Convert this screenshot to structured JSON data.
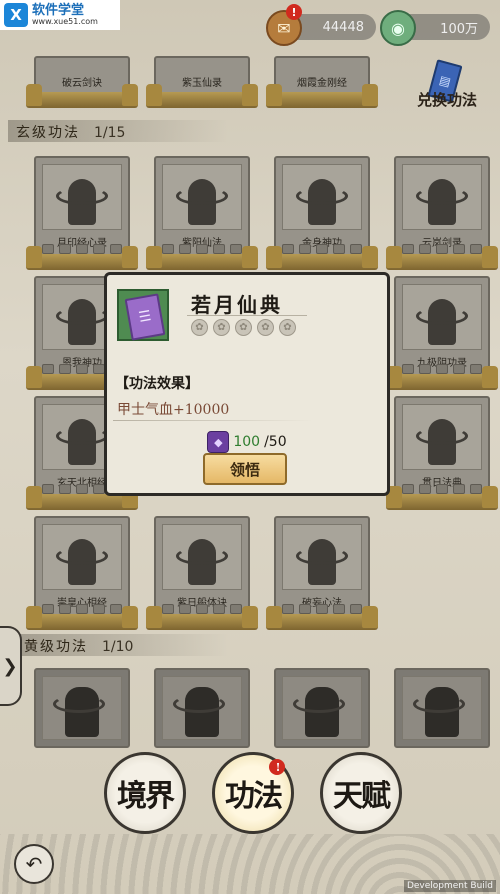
{
  "watermark": {
    "title": "软件学堂",
    "url": "www.xue51.com",
    "logo": "X"
  },
  "resources": [
    {
      "icon": "scroll-icon",
      "value": "44448",
      "badge": "!"
    },
    {
      "icon": "jade-icon",
      "value": "100万"
    }
  ],
  "exchange": {
    "label": "兑换功法"
  },
  "top_row": {
    "cards": [
      "破云剑诀",
      "紫玉仙录",
      "烟霞金刚经"
    ]
  },
  "sections": [
    {
      "name": "玄级功法",
      "count": "1/15"
    },
    {
      "name": "黄级功法",
      "count": "1/10"
    }
  ],
  "xuan_cards": [
    [
      "月印经心录",
      "紫阳仙法",
      "金身神功",
      "云岚剑录"
    ],
    [
      "恩我神功",
      "",
      "",
      "九极阴功录"
    ],
    [
      "玄天北相经",
      "",
      "",
      "贯日法典"
    ],
    [
      "崇皇心相经",
      "紫日般体诀",
      "破妄心法",
      ""
    ]
  ],
  "popup": {
    "title": "若月仙典",
    "effect_header": "【功法效果】",
    "effect_value": "甲士气血+10000",
    "cost_have": "100",
    "cost_need": "/50",
    "learn_label": "领悟"
  },
  "nav": [
    {
      "label": "境界"
    },
    {
      "label": "功法",
      "badge": "!"
    },
    {
      "label": "天赋"
    }
  ],
  "dev_build": "Development Build"
}
